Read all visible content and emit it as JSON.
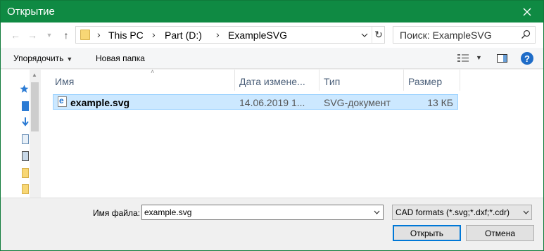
{
  "window": {
    "title": "Открытие",
    "accent": "#0f8a43"
  },
  "nav": {
    "back_icon": "back-arrow-icon",
    "forward_icon": "forward-arrow-icon",
    "recent_icon": "chevron-down-icon",
    "up_icon": "up-arrow-icon"
  },
  "address": {
    "crumbs": [
      "This PC",
      "Part (D:)",
      "ExampleSVG"
    ]
  },
  "search": {
    "placeholder": "Поиск: ExampleSVG"
  },
  "toolbar": {
    "organize_label": "Упорядочить",
    "new_folder_label": "Новая папка"
  },
  "columns": {
    "name": "Имя",
    "date": "Дата измене...",
    "type": "Тип",
    "size": "Размер"
  },
  "files": [
    {
      "name": "example.svg",
      "date": "14.06.2019 1...",
      "type": "SVG-документ",
      "size": "13 КБ"
    }
  ],
  "footer": {
    "filename_label": "Имя файла:",
    "filename_value": "example.svg",
    "filter_value": "CAD formats (*.svg;*.dxf;*.cdr)",
    "open_label": "Открыть",
    "cancel_label": "Отмена"
  }
}
